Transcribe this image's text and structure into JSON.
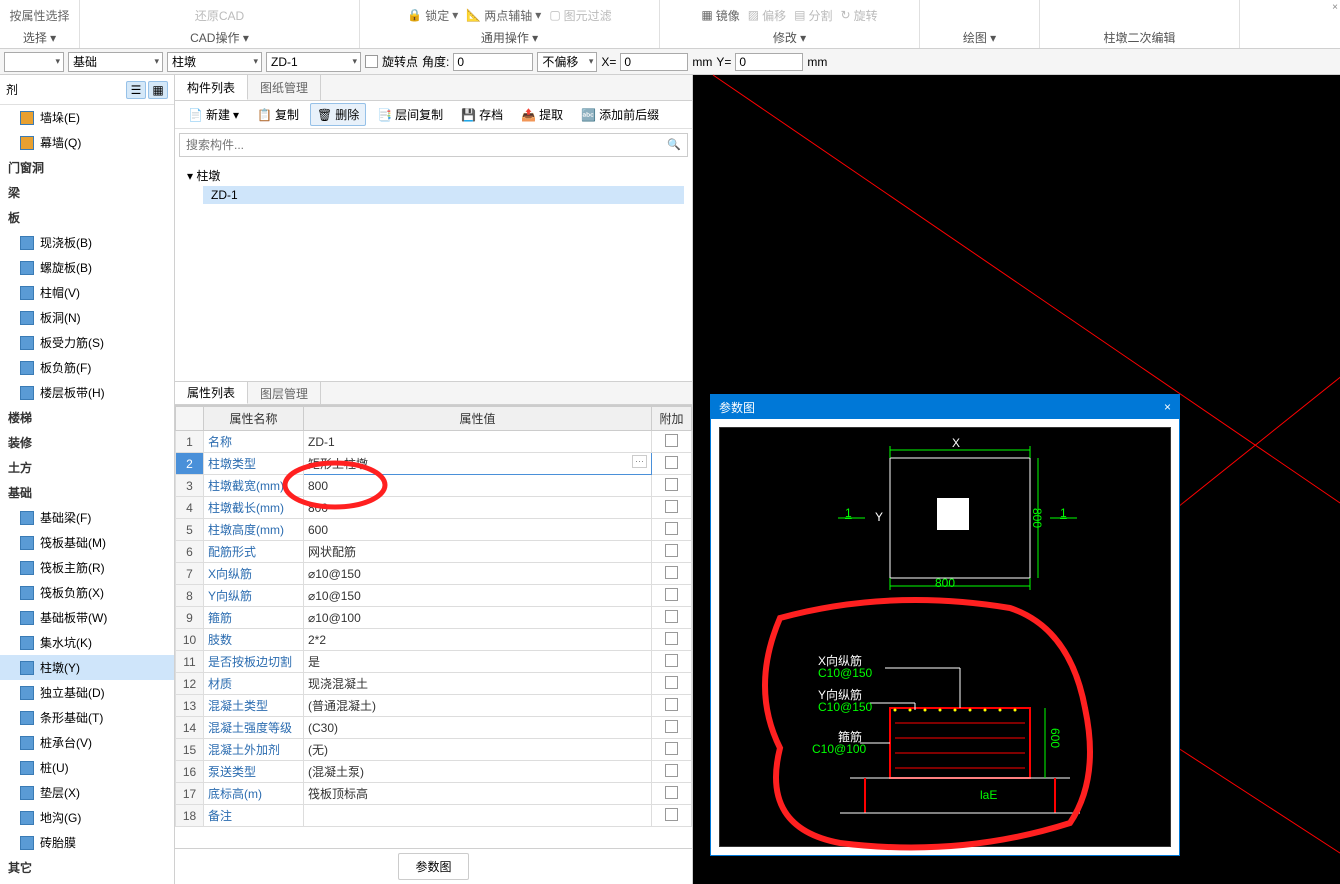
{
  "ribbon": {
    "select_attr": "按属性选择",
    "restore_cad": "还原CAD",
    "select_label": "选择",
    "cad_label": "CAD操作",
    "lock": "锁定",
    "snap": "两点辅轴",
    "filter": "图元过滤",
    "common_label": "通用操作",
    "mirror": "镜像",
    "offset": "偏移",
    "split": "分割",
    "rotate": "旋转",
    "modify_label": "修改",
    "draw_label": "绘图",
    "edit_label": "柱墩二次编辑"
  },
  "toolbar": {
    "combo1": "",
    "combo2": "基础",
    "combo3": "柱墩",
    "combo4": "ZD-1",
    "rotpoint": "旋转点",
    "angle_lbl": "角度:",
    "angle_val": "0",
    "offset_mode": "不偏移",
    "x_lbl": "X=",
    "x_val": "0",
    "mm1": "mm",
    "y_lbl": "Y=",
    "y_val": "0",
    "mm2": "mm"
  },
  "left": {
    "header": "剂",
    "items": [
      {
        "icon": "#e8a030",
        "label": "墙垛(E)"
      },
      {
        "icon": "#e8a030",
        "label": "幕墙(Q)"
      }
    ],
    "group1": "门窗洞",
    "group2": "梁",
    "group3": "板",
    "items2": [
      {
        "label": "现浇板(B)"
      },
      {
        "label": "螺旋板(B)"
      },
      {
        "label": "柱帽(V)"
      },
      {
        "label": "板洞(N)"
      },
      {
        "label": "板受力筋(S)"
      },
      {
        "label": "板负筋(F)"
      },
      {
        "label": "楼层板带(H)"
      }
    ],
    "group4": "楼梯",
    "group5": "装修",
    "group6": "土方",
    "group7": "基础",
    "items3": [
      {
        "label": "基础梁(F)"
      },
      {
        "label": "筏板基础(M)"
      },
      {
        "label": "筏板主筋(R)"
      },
      {
        "label": "筏板负筋(X)"
      },
      {
        "label": "基础板带(W)"
      },
      {
        "label": "集水坑(K)"
      },
      {
        "label": "柱墩(Y)",
        "selected": true
      },
      {
        "label": "独立基础(D)"
      },
      {
        "label": "条形基础(T)"
      },
      {
        "label": "桩承台(V)"
      },
      {
        "label": "桩(U)"
      },
      {
        "label": "垫层(X)"
      },
      {
        "label": "地沟(G)"
      },
      {
        "label": "砖胎膜"
      }
    ],
    "group8": "其它"
  },
  "mid": {
    "tab1": "构件列表",
    "tab2": "图纸管理",
    "new": "新建",
    "copy": "复制",
    "delete": "删除",
    "layer_copy": "层间复制",
    "archive": "存档",
    "extract": "提取",
    "prefix": "添加前后缀",
    "search_ph": "搜索构件...",
    "tree_root": "柱墩",
    "tree_child": "ZD-1",
    "prop_tab1": "属性列表",
    "prop_tab2": "图层管理",
    "col_name": "属性名称",
    "col_value": "属性值",
    "col_extra": "附加",
    "rows": [
      {
        "n": "1",
        "name": "名称",
        "val": "ZD-1"
      },
      {
        "n": "2",
        "name": "柱墩类型",
        "val": "矩形上柱墩",
        "sel": true
      },
      {
        "n": "3",
        "name": "柱墩截宽(mm)",
        "val": "800"
      },
      {
        "n": "4",
        "name": "柱墩截长(mm)",
        "val": "800"
      },
      {
        "n": "5",
        "name": "柱墩高度(mm)",
        "val": "600"
      },
      {
        "n": "6",
        "name": "配筋形式",
        "val": "网状配筋"
      },
      {
        "n": "7",
        "name": "X向纵筋",
        "val": "⌀10@150"
      },
      {
        "n": "8",
        "name": "Y向纵筋",
        "val": "⌀10@150"
      },
      {
        "n": "9",
        "name": "箍筋",
        "val": "⌀10@100"
      },
      {
        "n": "10",
        "name": "肢数",
        "val": "2*2"
      },
      {
        "n": "11",
        "name": "是否按板边切割",
        "val": "是"
      },
      {
        "n": "12",
        "name": "材质",
        "val": "现浇混凝土"
      },
      {
        "n": "13",
        "name": "混凝土类型",
        "val": "(普通混凝土)"
      },
      {
        "n": "14",
        "name": "混凝土强度等级",
        "val": "(C30)"
      },
      {
        "n": "15",
        "name": "混凝土外加剂",
        "val": "(无)"
      },
      {
        "n": "16",
        "name": "泵送类型",
        "val": "(混凝土泵)"
      },
      {
        "n": "17",
        "name": "底标高(m)",
        "val": "筏板顶标高"
      },
      {
        "n": "18",
        "name": "备注",
        "val": ""
      }
    ],
    "param_btn": "参数图"
  },
  "dialog": {
    "title": "参数图",
    "x_label": "X",
    "y_label": "Y",
    "dim_800_h": "800",
    "dim_800_v": "800",
    "dim_600": "600",
    "dim_1": "1",
    "xbar": "X向纵筋",
    "xbar_v": "C10@150",
    "ybar": "Y向纵筋",
    "ybar_v": "C10@150",
    "stirrup": "箍筋",
    "stirrup_v": "C10@100",
    "lae": "laE"
  }
}
